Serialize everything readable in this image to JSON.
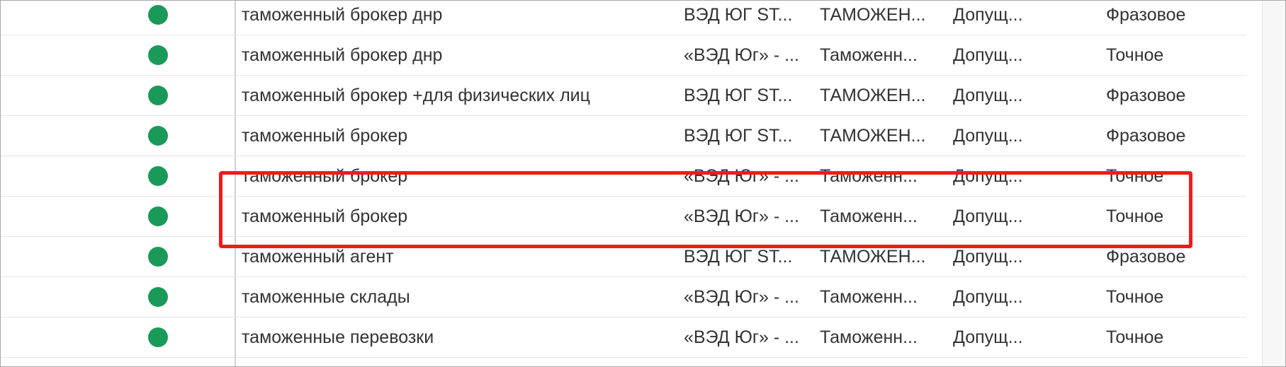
{
  "colors": {
    "status_dot": "#1a9a58",
    "highlight": "#f21a1a",
    "text": "#333333"
  },
  "rows": [
    {
      "status_icon": "green-dot-icon",
      "phrase": "таможенный брокер днр",
      "campaign": "ВЭД ЮГ ST...",
      "group": "ТАМОЖЕН...",
      "status": "Допущ...",
      "match": "Фразовое"
    },
    {
      "status_icon": "green-dot-icon",
      "phrase": "таможенный брокер днр",
      "campaign": "«ВЭД Юг» - ...",
      "group": "Таможенн...",
      "status": "Допущ...",
      "match": "Точное"
    },
    {
      "status_icon": "green-dot-icon",
      "phrase": "таможенный брокер +для физических лиц",
      "campaign": "ВЭД ЮГ ST...",
      "group": "ТАМОЖЕН...",
      "status": "Допущ...",
      "match": "Фразовое"
    },
    {
      "status_icon": "green-dot-icon",
      "phrase": "таможенный брокер",
      "campaign": "ВЭД ЮГ ST...",
      "group": "ТАМОЖЕН...",
      "status": "Допущ...",
      "match": "Фразовое"
    },
    {
      "status_icon": "green-dot-icon",
      "phrase": "таможенный брокер",
      "campaign": "«ВЭД Юг» - ...",
      "group": "Таможенн...",
      "status": "Допущ...",
      "match": "Точное"
    },
    {
      "status_icon": "green-dot-icon",
      "phrase": "таможенный брокер",
      "campaign": "«ВЭД Юг» - ...",
      "group": "Таможенн...",
      "status": "Допущ...",
      "match": "Точное"
    },
    {
      "status_icon": "green-dot-icon",
      "phrase": "таможенный агент",
      "campaign": "ВЭД ЮГ ST...",
      "group": "ТАМОЖЕН...",
      "status": "Допущ...",
      "match": "Фразовое"
    },
    {
      "status_icon": "green-dot-icon",
      "phrase": "таможенные склады",
      "campaign": "«ВЭД Юг» - ...",
      "group": "Таможенн...",
      "status": "Допущ...",
      "match": "Точное"
    },
    {
      "status_icon": "green-dot-icon",
      "phrase": "таможенные перевозки",
      "campaign": "«ВЭД Юг» - ...",
      "group": "Таможенн...",
      "status": "Допущ...",
      "match": "Точное"
    }
  ]
}
